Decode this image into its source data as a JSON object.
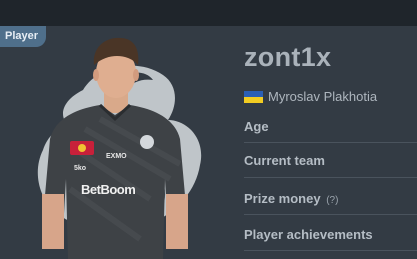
{
  "badge": {
    "label": "Player"
  },
  "player": {
    "nickname": "zont1x",
    "country_flag": "ukraine-flag-icon",
    "full_name": "Myroslav Plakhotia"
  },
  "fields": {
    "age": "Age",
    "current_team": "Current team",
    "prize_money": "Prize money",
    "prize_money_hint": "(?)",
    "achievements": "Player achievements"
  },
  "jersey": {
    "sponsor_main": "BetBoom",
    "sponsor_secondary": "EXMO",
    "sponsor_small": "5ko"
  },
  "colors": {
    "background": "#333b44",
    "badge": "#4f6f8b",
    "text_primary": "#aab2ba",
    "flag_blue": "#2b5fb5",
    "flag_yellow": "#f2cc22"
  }
}
